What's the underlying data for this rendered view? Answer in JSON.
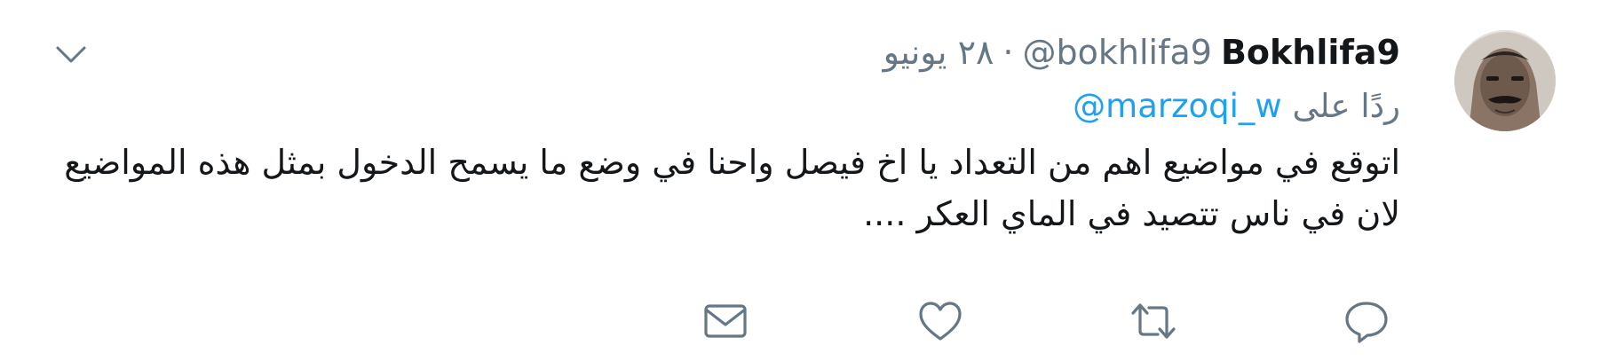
{
  "tweet": {
    "display_name": "Bokhlifa9",
    "username": "@bokhlifa9",
    "separator": "·",
    "date": "٢٨ يونيو",
    "reply_prefix": "ردًا على",
    "reply_to": "@marzoqi_w",
    "text": "اتوقع في مواضيع اهم من التعداد يا اخ فيصل واحنا في وضع ما يسمح الدخول بمثل هذه المواضيع لان في ناس تتصيد في الماي العكر ...."
  },
  "colors": {
    "text": "#14171a",
    "secondary": "#657786",
    "link": "#1da1f2",
    "icon": "#657786"
  },
  "icons": {
    "caret": "chevron-down-icon",
    "reply": "reply-icon",
    "retweet": "retweet-icon",
    "like": "heart-icon",
    "dm": "envelope-icon"
  }
}
